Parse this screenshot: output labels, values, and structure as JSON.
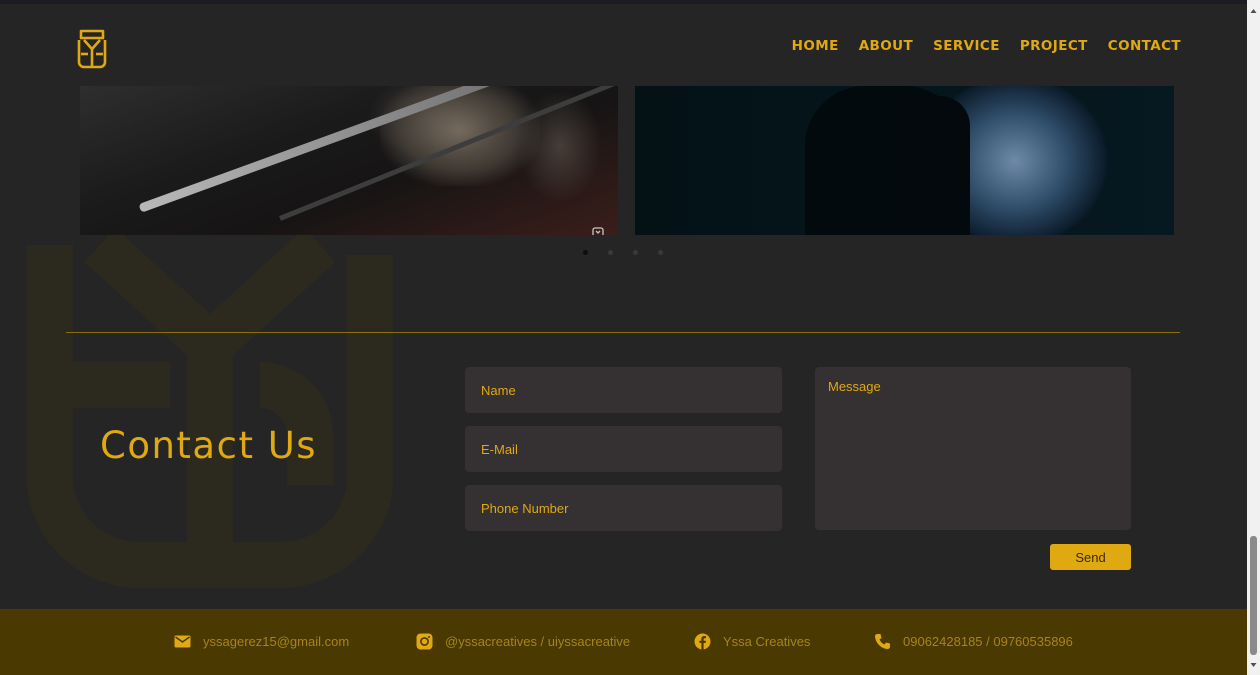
{
  "nav": {
    "items": [
      "HOME",
      "ABOUT",
      "SERVICE",
      "PROJECT",
      "CONTACT"
    ]
  },
  "contact": {
    "title": "Contact Us",
    "name_placeholder": "Name",
    "email_placeholder": "E-Mail",
    "phone_placeholder": "Phone Number",
    "message_placeholder": "Message",
    "send_label": "Send"
  },
  "footer": {
    "email": "yssagerez15@gmail.com",
    "instagram": "@yssacreatives / uiyssacreative",
    "facebook": "Yssa Creatives",
    "phone": "09062428185 / 09760535896"
  },
  "gallery": {
    "active_slide": 1,
    "slide_count": 4
  },
  "icons": [
    "logo-icon",
    "email-icon",
    "instagram-icon",
    "facebook-icon",
    "phone-icon"
  ],
  "colors": {
    "accent": "#e0a811",
    "background": "#252525",
    "field_bg": "#353132",
    "footer_bg": "#4a3900",
    "footer_text": "#a58418"
  }
}
